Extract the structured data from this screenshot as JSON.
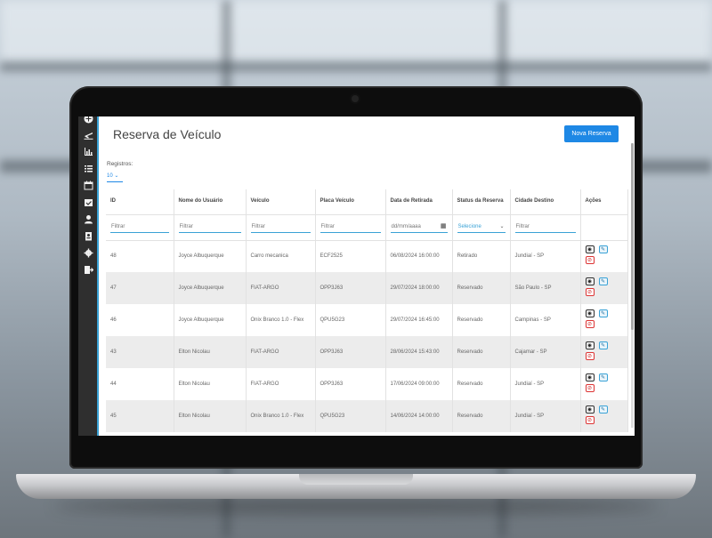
{
  "app": {
    "page_title": "Reserva de Veículo",
    "new_button": "Nova Reserva",
    "records_label": "Registros:",
    "records_value": "10"
  },
  "sidebar": {
    "icons": [
      "add-circle-icon",
      "plane-icon",
      "bar-chart-icon",
      "list-icon",
      "calendar-icon",
      "calendar-check-icon",
      "user-icon",
      "id-card-icon",
      "gear-icon",
      "logout-icon"
    ]
  },
  "table": {
    "columns": [
      "ID",
      "Nome do Usuário",
      "Veículo",
      "Placa Veículo",
      "Data de Retirada",
      "Status da Reserva",
      "Cidade Destino",
      "Ações"
    ],
    "filters": {
      "text_placeholder": "Filtrar",
      "date_placeholder": "dd/mm/aaaa",
      "status_placeholder": "Selecione"
    },
    "rows": [
      {
        "id": "48",
        "user": "Joyce Albuquerque",
        "vehicle": "Carro mecanica",
        "plate": "ECF2525",
        "date": "06/08/2024 16:00:00",
        "status": "Retirado",
        "city": "Jundiaí - SP"
      },
      {
        "id": "47",
        "user": "Joyce Albuquerque",
        "vehicle": "FIAT-ARGO",
        "plate": "OPP3J63",
        "date": "29/07/2024 18:00:00",
        "status": "Reservado",
        "city": "São Paulo - SP"
      },
      {
        "id": "46",
        "user": "Joyce Albuquerque",
        "vehicle": "Onix Branco 1.0 - Flex",
        "plate": "QPU5G23",
        "date": "29/07/2024 16:45:00",
        "status": "Reservado",
        "city": "Campinas - SP"
      },
      {
        "id": "43",
        "user": "Elton Nicolau",
        "vehicle": "FIAT-ARGO",
        "plate": "OPP3J63",
        "date": "28/06/2024 15:43:00",
        "status": "Reservado",
        "city": "Cajamar - SP"
      },
      {
        "id": "44",
        "user": "Elton Nicolau",
        "vehicle": "FIAT-ARGO",
        "plate": "OPP3J63",
        "date": "17/06/2024 09:00:00",
        "status": "Reservado",
        "city": "Jundiaí - SP"
      },
      {
        "id": "45",
        "user": "Elton Nicolau",
        "vehicle": "Onix Branco 1.0 - Flex",
        "plate": "QPU5G23",
        "date": "14/06/2024 14:00:00",
        "status": "Reservado",
        "city": "Jundiaí - SP"
      }
    ]
  },
  "colors": {
    "accent": "#1e88e5",
    "sidebar": "#2f2f2f",
    "sidebar_border": "#3aa2d6",
    "cancel": "#d33333"
  }
}
